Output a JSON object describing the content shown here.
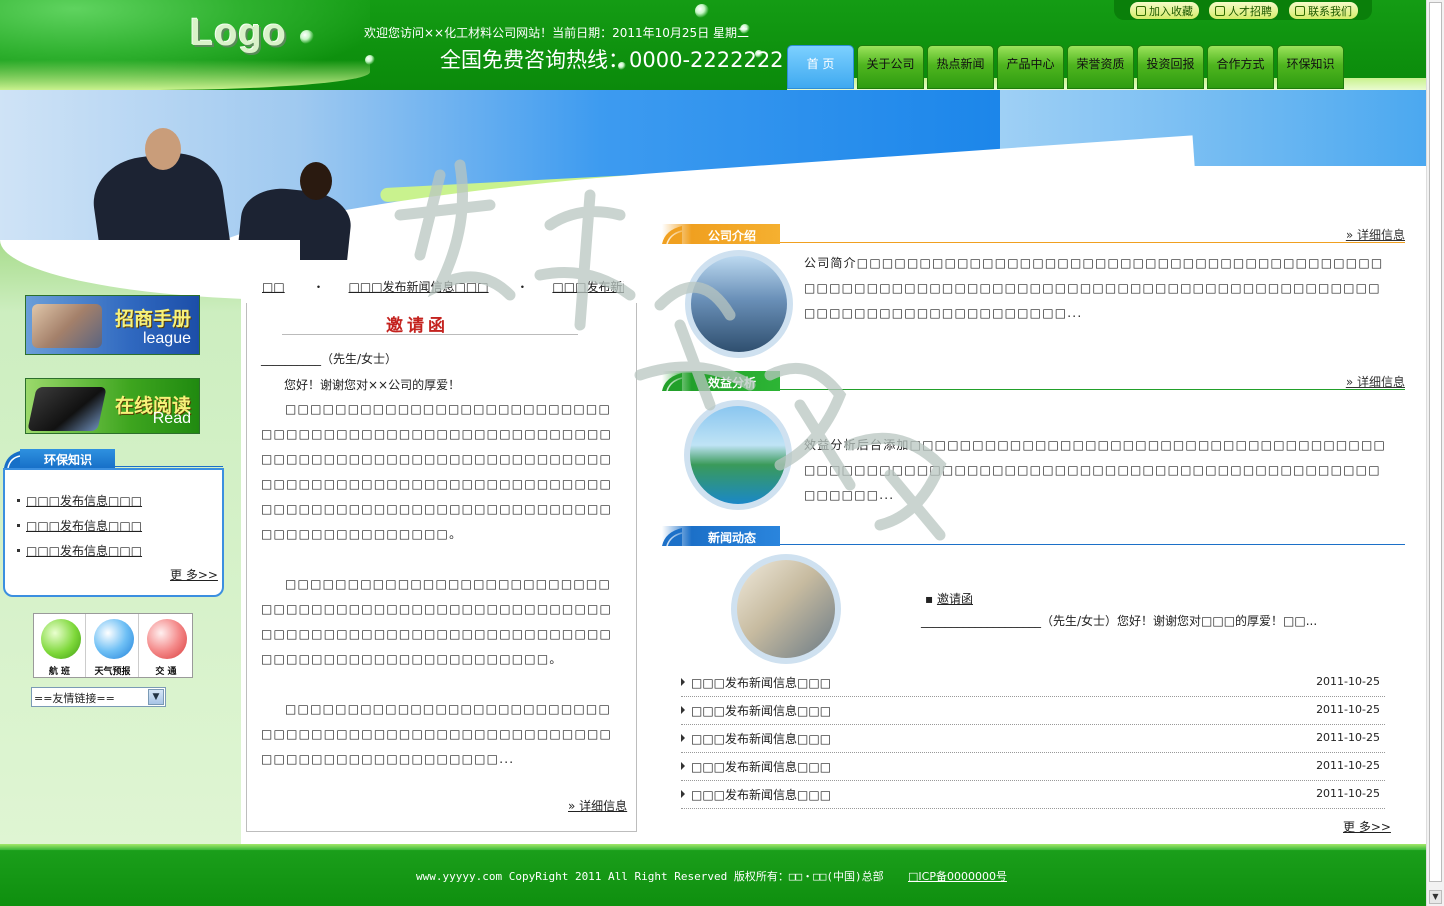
{
  "header": {
    "logo": "Logo",
    "welcome": "欢迎您访问××化工材料公司网站！当前日期：2011年10月25日  星期二",
    "top_links": [
      {
        "label": "加入收藏",
        "icon": "home-icon"
      },
      {
        "label": "人才招聘",
        "icon": "people-icon"
      },
      {
        "label": "联系我们",
        "icon": "contact-icon"
      }
    ]
  },
  "nav": [
    {
      "label": "首 页",
      "active": true
    },
    {
      "label": "关于公司"
    },
    {
      "label": "热点新闻"
    },
    {
      "label": "产品中心"
    },
    {
      "label": "荣誉资质"
    },
    {
      "label": "投资回报"
    },
    {
      "label": "合作方式"
    },
    {
      "label": "环保知识"
    }
  ],
  "banner": {
    "hotline": "全国免费咨询热线：0000-2222222"
  },
  "left": {
    "league": {
      "title": "招商手册",
      "sub": "league"
    },
    "read": {
      "title": "在线阅读",
      "sub": "Read"
    },
    "env": {
      "title": "环保知识",
      "items": [
        "□□□发布信息□□□",
        "□□□发布信息□□□",
        "□□□发布信息□□□"
      ],
      "more": "更 多>>"
    },
    "icons": [
      {
        "label": "航  班",
        "icon": "airplane-icon"
      },
      {
        "label": "天气预报",
        "icon": "weather-icon"
      },
      {
        "label": "交  通",
        "icon": "train-icon"
      }
    ],
    "friend_select": "==友情链接=="
  },
  "marquee": [
    "□□",
    "□□□发布新闻信息□□□",
    "□□□发布新闻信息"
  ],
  "invite": {
    "title": "邀请函",
    "salute": "__________（先生/女士）",
    "greeting": "您好！谢谢您对××公司的厚爱！",
    "paragraphs": [
      "□□□□□□□□□□□□□□□□□□□□□□□□□□□□□□□□□□□□□□□□□□□□□□□□□□□□□□□□□□□□□□□□□□□□□□□□□□□□□□□□□□□□□□□□□□□□□□□□□□□□□□□□□□□□□□□□□□□□□□□□□□□□□□□□□□□□□□□□□□□□□□□□□□□□□□□□□。",
      "□□□□□□□□□□□□□□□□□□□□□□□□□□□□□□□□□□□□□□□□□□□□□□□□□□□□□□□□□□□□□□□□□□□□□□□□□□□□□□□□□□□□□□□□□□□□□□□□□□□□□□□□□。",
      "□□□□□□□□□□□□□□□□□□□□□□□□□□□□□□□□□□□□□□□□□□□□□□□□□□□□□□□□□□□□□□□□□□□□□□□□□..."
    ],
    "more": "» 详细信息"
  },
  "about": {
    "title": "公司介绍",
    "more": "» 详细信息",
    "text": "公司简介□□□□□□□□□□□□□□□□□□□□□□□□□□□□□□□□□□□□□□□□□□□□□□□□□□□□□□□□□□□□□□□□□□□□□□□□□□□□□□□□□□□□□□□□□□□□□□□□□□□□□□□□□□□□□..."
  },
  "benefit": {
    "title": "效益分析",
    "more": "» 详细信息",
    "text": "效益分析后台添加□□□□□□□□□□□□□□□□□□□□□□□□□□□□□□□□□□□□□□□□□□□□□□□□□□□□□□□□□□□□□□□□□□□□□□□□□□□□□□□□□□□□□□□□□□..."
  },
  "news": {
    "title": "新闻动态",
    "featured_title": "邀请函",
    "featured_sub": "____________________（先生/女士）您好！谢谢您对□□□的厚爱！□□...",
    "items": [
      {
        "title": "□□□发布新闻信息□□□",
        "date": "2011-10-25"
      },
      {
        "title": "□□□发布新闻信息□□□",
        "date": "2011-10-25"
      },
      {
        "title": "□□□发布新闻信息□□□",
        "date": "2011-10-25"
      },
      {
        "title": "□□□发布新闻信息□□□",
        "date": "2011-10-25"
      },
      {
        "title": "□□□发布新闻信息□□□",
        "date": "2011-10-25"
      }
    ],
    "more": "更 多>>"
  },
  "footer": {
    "copyright": "www.yyyyy.com CopyRight 2011 All Right Reserved 版权所有：□□・□□(中国)总部",
    "icp": "□ICP备0000000号"
  },
  "colors": {
    "header_green": "#0d8f0d",
    "banner_blue": "#1c86ea",
    "invite_red": "#c4231f",
    "section_orange": "#f0a020",
    "section_green": "#22a02a",
    "section_blue": "#1c70c8"
  }
}
